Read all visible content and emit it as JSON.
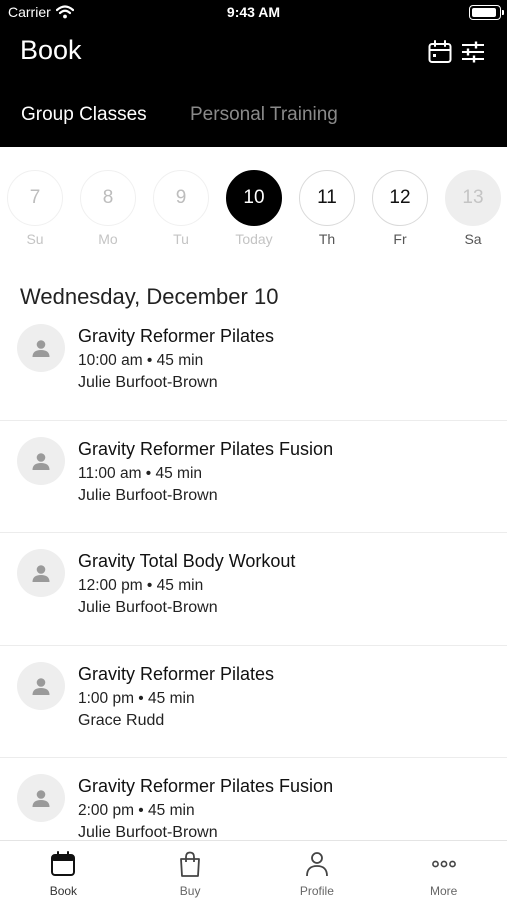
{
  "status_bar": {
    "carrier": "Carrier",
    "time": "9:43 AM",
    "battery_level": 0.95
  },
  "header": {
    "title": "Book",
    "icons": [
      "calendar-icon",
      "filter-sliders-icon"
    ],
    "tabs": [
      {
        "label": "Group Classes",
        "active": true
      },
      {
        "label": "Personal Training",
        "active": false
      }
    ]
  },
  "week": [
    {
      "num": "7",
      "label": "Su",
      "state": "past"
    },
    {
      "num": "8",
      "label": "Mo",
      "state": "past"
    },
    {
      "num": "9",
      "label": "Tu",
      "state": "past"
    },
    {
      "num": "10",
      "label": "Today",
      "state": "selected"
    },
    {
      "num": "11",
      "label": "Th",
      "state": "future"
    },
    {
      "num": "12",
      "label": "Fr",
      "state": "future"
    },
    {
      "num": "13",
      "label": "Sa",
      "state": "disabled"
    }
  ],
  "date_heading": "Wednesday, December 10",
  "classes": [
    {
      "name": "Gravity Reformer Pilates",
      "time": "10:00 am • 45 min",
      "instructor": "Julie Burfoot-Brown"
    },
    {
      "name": "Gravity Reformer Pilates Fusion",
      "time": "11:00 am • 45 min",
      "instructor": "Julie Burfoot-Brown"
    },
    {
      "name": "Gravity Total Body Workout",
      "time": "12:00 pm • 45 min",
      "instructor": "Julie Burfoot-Brown"
    },
    {
      "name": "Gravity Reformer Pilates",
      "time": "1:00 pm • 45 min",
      "instructor": "Grace Rudd"
    },
    {
      "name": "Gravity Reformer Pilates Fusion",
      "time": "2:00 pm • 45 min",
      "instructor": "Julie Burfoot-Brown"
    }
  ],
  "tabbar": [
    {
      "label": "Book",
      "icon": "calendar-icon",
      "active": true
    },
    {
      "label": "Buy",
      "icon": "shopping-bag-icon",
      "active": false
    },
    {
      "label": "Profile",
      "icon": "person-icon",
      "active": false
    },
    {
      "label": "More",
      "icon": "ellipsis-icon",
      "active": false
    }
  ],
  "colors": {
    "header_bg": "#000000",
    "selected_day": "#000000",
    "inactive_tab": "#8a8a8a",
    "avatar_bg": "#eeeeee"
  }
}
